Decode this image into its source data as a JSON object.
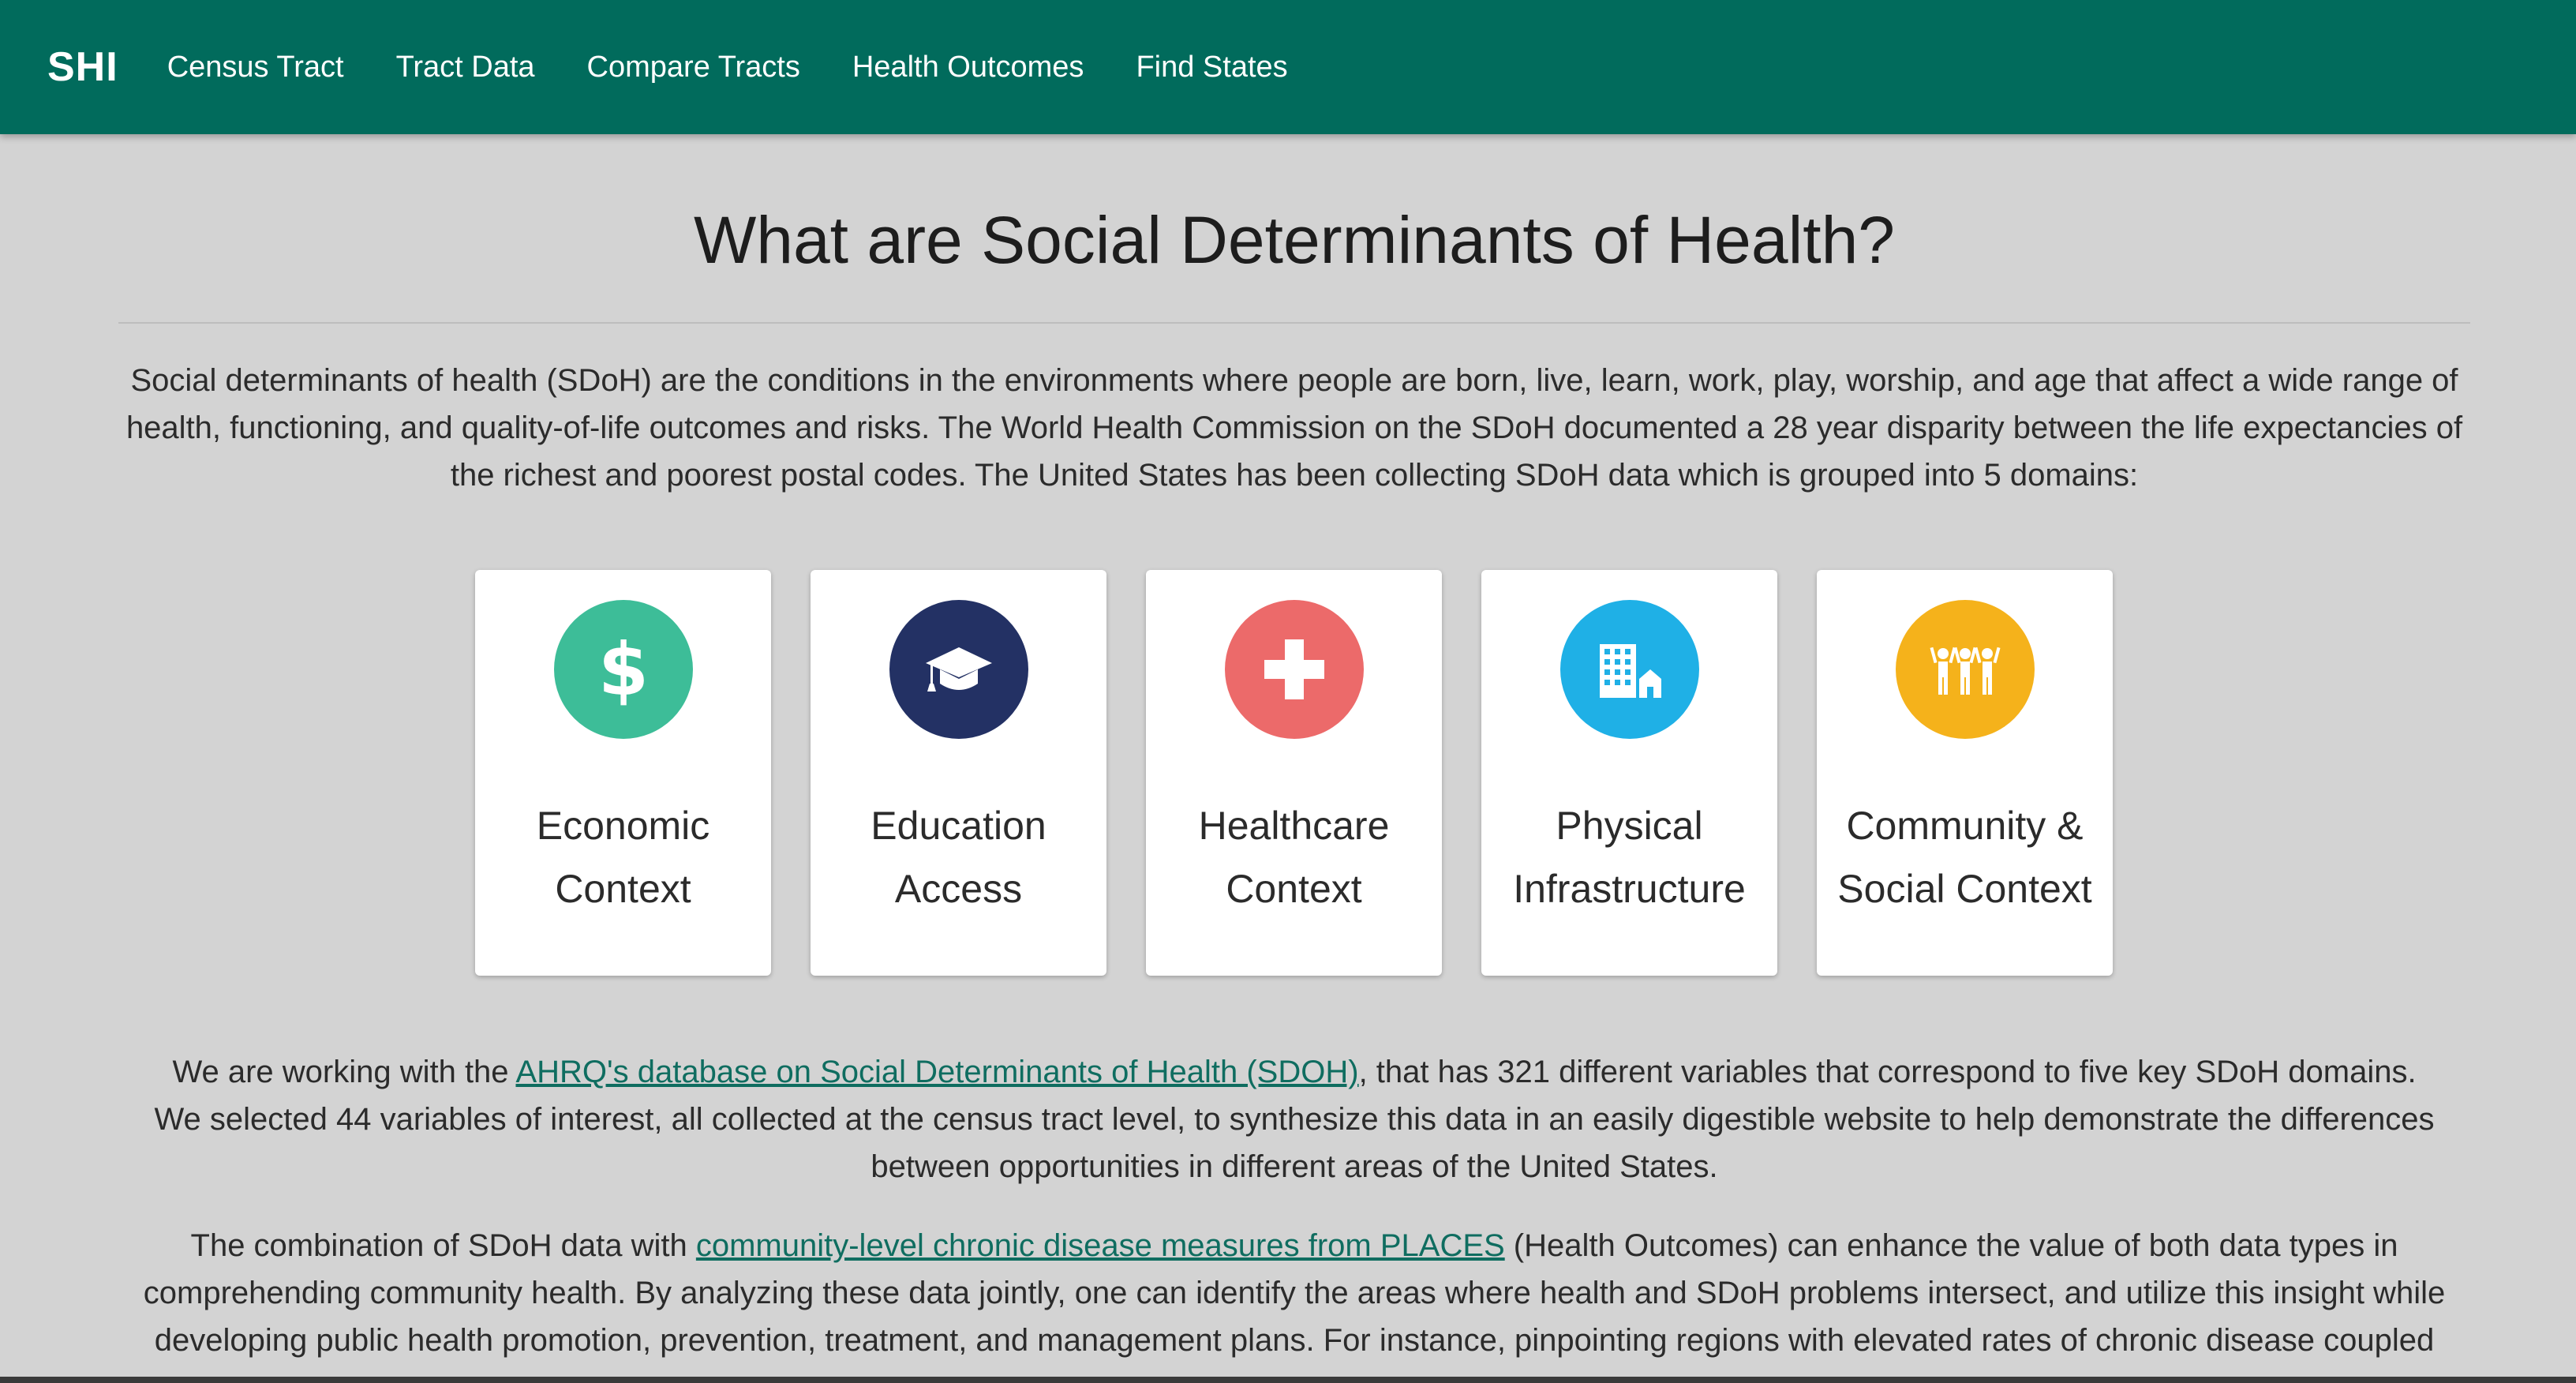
{
  "nav": {
    "brand": "SHI",
    "links": [
      "Census Tract",
      "Tract Data",
      "Compare Tracts",
      "Health Outcomes",
      "Find States"
    ]
  },
  "main": {
    "title": "What are Social Determinants of Health?",
    "intro": "Social determinants of health (SDoH) are the conditions in the environments where people are born, live, learn, work, play, worship, and age that affect a wide range of health, functioning, and quality-of-life outcomes and risks. The World Health Commission on the SDoH documented a 28 year disparity between the life expectancies of the richest and poorest postal codes. The United States has been collecting SDoH data which is grouped into 5 domains:",
    "domains": [
      {
        "line1": "Economic",
        "line2": "Context",
        "color": "#3dbd98",
        "icon": "dollar-icon"
      },
      {
        "line1": "Education",
        "line2": "Access",
        "color": "#233164",
        "icon": "graduation-cap-icon"
      },
      {
        "line1": "Healthcare",
        "line2": "Context",
        "color": "#ec6a6a",
        "icon": "medical-cross-icon"
      },
      {
        "line1": "Physical",
        "line2": "Infrastructure",
        "color": "#1fb0e6",
        "icon": "buildings-icon"
      },
      {
        "line1": "Community &",
        "line2": "Social Context",
        "color": "#f5b21b",
        "icon": "community-people-icon"
      }
    ],
    "para2": {
      "before": "We are working with the ",
      "link": "AHRQ's database on Social Determinants of Health (SDOH)",
      "after": ", that has 321 different variables that correspond to five key SDoH domains. We selected 44 variables of interest, all collected at the census tract level, to synthesize this data in an easily digestible website to help demonstrate the differences between opportunities in different areas of the United States."
    },
    "para3": {
      "before": "The combination of SDoH data with ",
      "link": "community-level chronic disease measures from PLACES",
      "after": " (Health Outcomes) can enhance the value of both data types in comprehending community health. By analyzing these data jointly, one can identify the areas where health and SDoH problems intersect, and utilize this insight while developing public health promotion, prevention, treatment, and management plans. For instance, pinpointing regions with elevated rates of chronic disease coupled"
    }
  },
  "colors": {
    "navbar": "#016b5c",
    "background": "#d3d3d3",
    "link": "#0f6d60"
  }
}
